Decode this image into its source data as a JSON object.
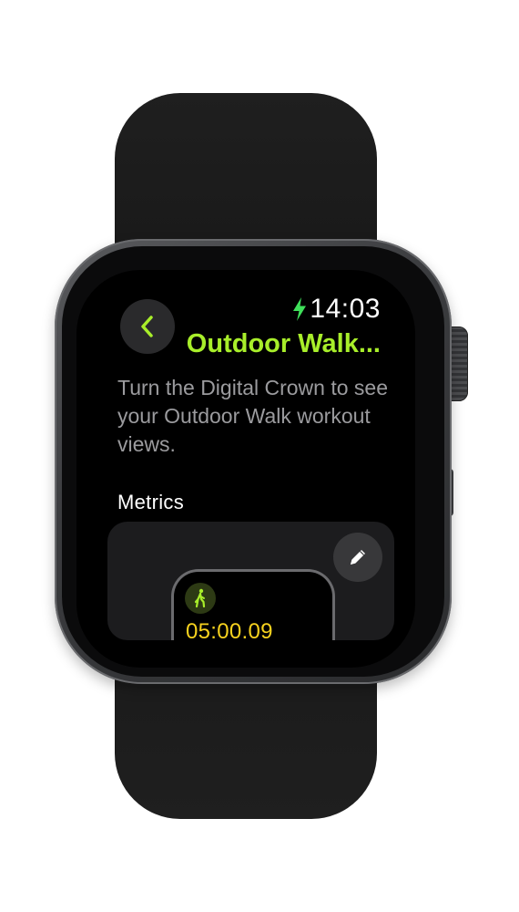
{
  "status": {
    "time": "14:03",
    "charging_icon": "bolt-icon"
  },
  "header": {
    "back_icon": "chevron-left-icon",
    "title": "Outdoor Walk..."
  },
  "description": "Turn the Digital Crown to see your Outdoor Walk workout views.",
  "metrics": {
    "section_title": "Metrics",
    "edit_icon": "pencil-icon",
    "preview": {
      "workout_icon": "walking-figure-icon",
      "elapsed_time": "05:00.09"
    }
  },
  "colors": {
    "accent_green": "#a8ee2a",
    "time_yellow": "#f7d21e",
    "secondary_text": "#9b9b9e"
  }
}
